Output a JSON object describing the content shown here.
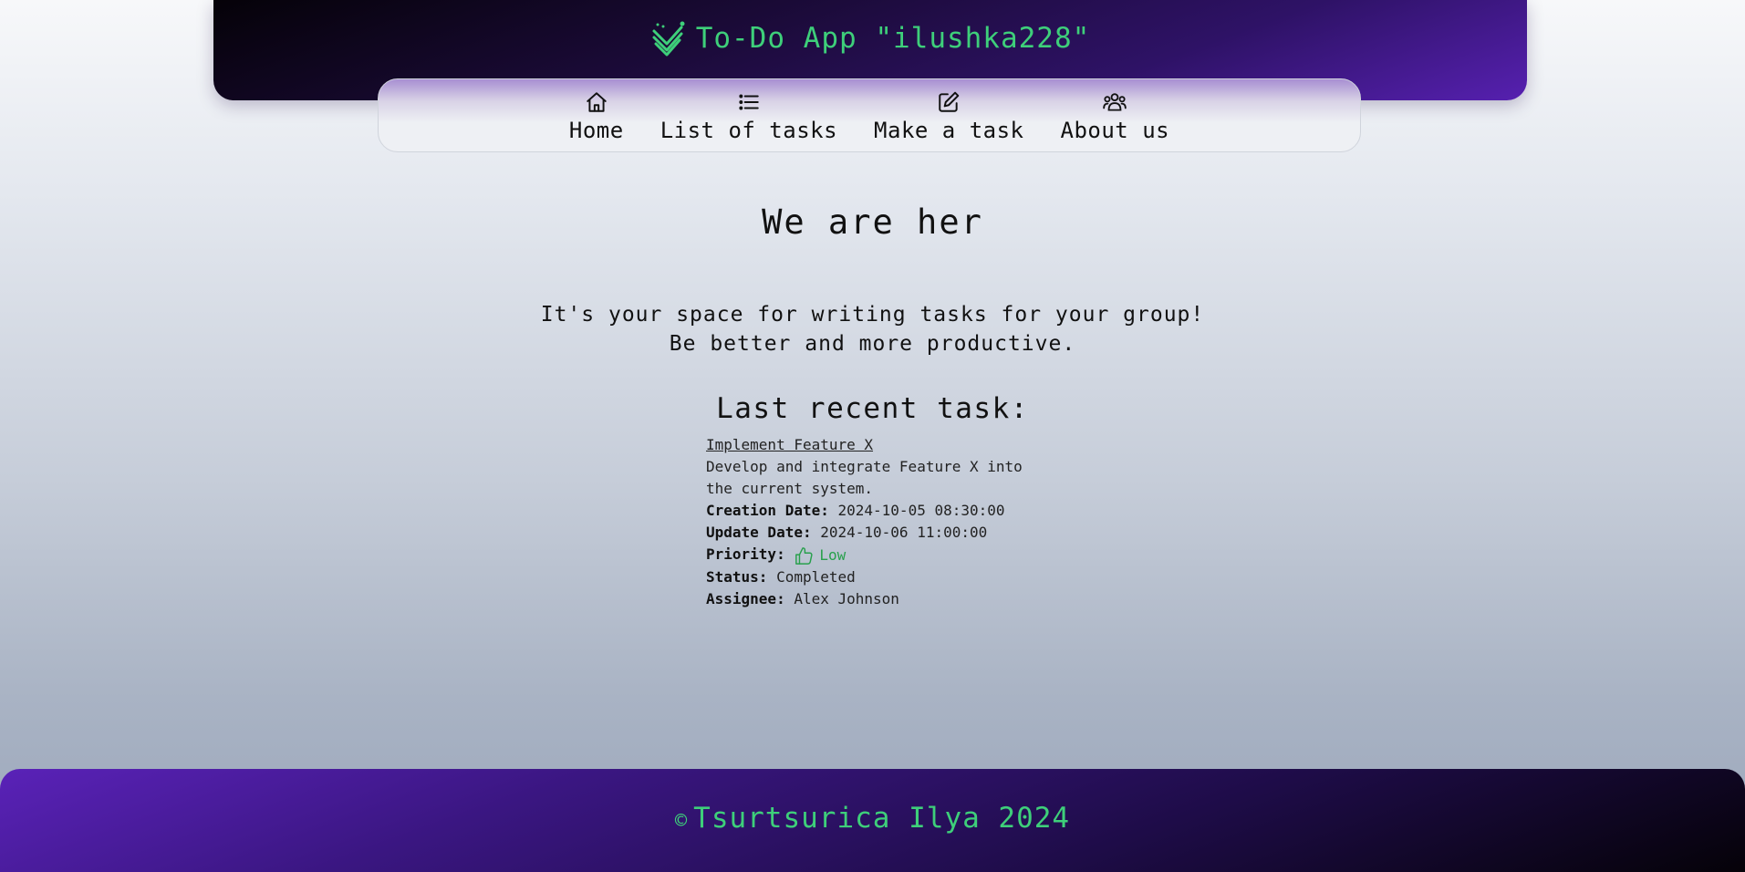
{
  "header": {
    "title": "To-Do App \"ilushka228\"",
    "logo_icon": "check-stack-icon",
    "accent_color": "#3ecf7a"
  },
  "nav": {
    "items": [
      {
        "label": "Home",
        "icon": "home-icon"
      },
      {
        "label": "List of tasks",
        "icon": "list-icon"
      },
      {
        "label": "Make a task",
        "icon": "edit-icon"
      },
      {
        "label": "About us",
        "icon": "users-icon"
      }
    ]
  },
  "main": {
    "title": "We are her",
    "intro_lines": [
      "It's your space for writing tasks for your group!",
      "Be better and more productive."
    ],
    "recent_heading": "Last recent task:"
  },
  "task": {
    "title": "Implement Feature X",
    "description": "Develop and integrate Feature X into the current system.",
    "creation_label": "Creation Date:",
    "creation_value": "2024-10-05 08:30:00",
    "update_label": "Update Date:",
    "update_value": "2024-10-06 11:00:00",
    "priority_label": "Priority:",
    "priority_value": "Low",
    "priority_icon": "thumbs-up-icon",
    "priority_color": "#28a04c",
    "status_label": "Status:",
    "status_value": "Completed",
    "assignee_label": "Assignee:",
    "assignee_value": "Alex Johnson"
  },
  "footer": {
    "copyright_symbol": "©",
    "text": "Tsurtsurica Ilya 2024"
  }
}
